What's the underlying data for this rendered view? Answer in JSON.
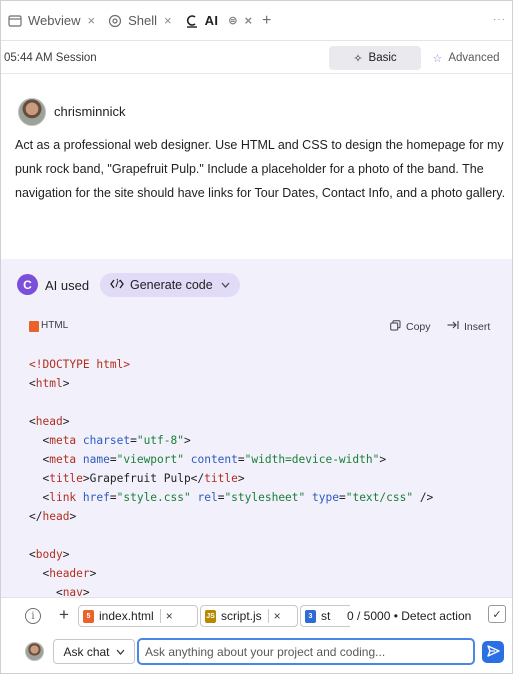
{
  "tabs": [
    {
      "label": "Webview",
      "icon": "window-icon",
      "close": "×"
    },
    {
      "label": "Shell",
      "icon": "shell-icon",
      "close": "×"
    },
    {
      "label": "AI",
      "icon": "ai-icon",
      "close": "×",
      "pin": "⊜",
      "active": true
    }
  ],
  "tabbar": {
    "add": "+",
    "more": "···"
  },
  "session": {
    "title": "05:44 AM Session",
    "modes": [
      {
        "label": "Basic",
        "icon": "sparkle-icon",
        "glyph": "✧",
        "selected": true
      },
      {
        "label": "Advanced",
        "icon": "star-icon",
        "glyph": "☆",
        "selected": false
      }
    ]
  },
  "user_message": {
    "username": "chrisminnick",
    "text": "Act as a professional web designer. Use HTML and CSS to design the homepage for my punk rock band, \"Grapefruit Pulp.\" Include a placeholder for a photo of the band. The navigation for the site should have links for Tour Dates, Contact Info, and a photo gallery."
  },
  "ai_response": {
    "logo_glyph": "C",
    "used_label": "AI used",
    "tool_label": "Generate code",
    "tool_glyph": "<⁄>",
    "code_lang": "HTML",
    "copy_label": "Copy",
    "insert_label": "Insert",
    "code_lines": [
      "<!DOCTYPE html>",
      "<html>",
      "",
      "<head>",
      "  <meta charset=\"utf-8\">",
      "  <meta name=\"viewport\" content=\"width=device-width\">",
      "  <title>Grapefruit Pulp</title>",
      "  <link href=\"style.css\" rel=\"stylesheet\" type=\"text/css\" />",
      "</head>",
      "",
      "<body>",
      "  <header>",
      "    <nav>"
    ]
  },
  "composer": {
    "info_glyph": "i",
    "plus_glyph": "+",
    "files": [
      {
        "name": "index.html",
        "badge": "5",
        "kind": "html"
      },
      {
        "name": "script.js",
        "badge": "JS",
        "kind": "js"
      },
      {
        "name": "st",
        "badge": "3",
        "kind": "css"
      }
    ],
    "close_glyph": "×",
    "counter": "0 / 5000",
    "detect_label": "• Detect action",
    "check_glyph": "✓",
    "mode_label": "Ask chat",
    "input_value": "",
    "input_placeholder": "Ask anything about your project and coding...",
    "send_glyph": "➤"
  },
  "colors": {
    "accent": "#7b4fd9",
    "ai_background": "#f2f0fb",
    "send_button": "#2b6fe5",
    "tag": "#b0301f",
    "attribute": "#2d5bbf",
    "string": "#1a7f37"
  }
}
